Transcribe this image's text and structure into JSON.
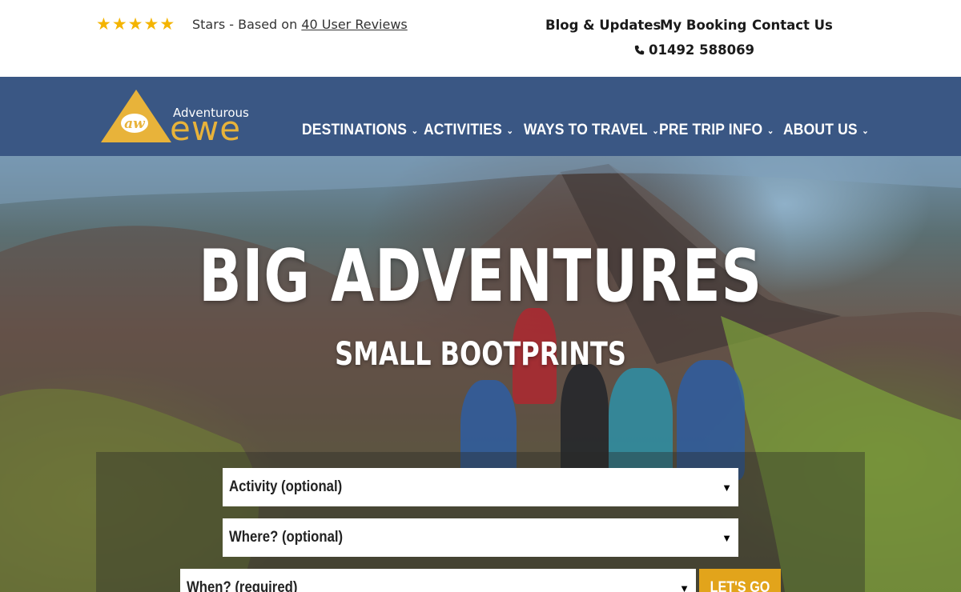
{
  "rating": {
    "stars": 5,
    "text_prefix": "Stars - Based on",
    "reviews_link": "40 User Reviews"
  },
  "top_links": {
    "blog": "Blog & Updates",
    "booking": "My Booking",
    "contact": "Contact Us",
    "phone": "01492 588069"
  },
  "logo": {
    "small": "Adventurous",
    "big": "ewe",
    "badge": "aw"
  },
  "nav": {
    "destinations": "DESTINATIONS",
    "activities": "ACTIVITIES",
    "ways": "WAYS TO TRAVEL",
    "pretrip": "PRE TRIP INFO",
    "about": "ABOUT US"
  },
  "hero": {
    "title": "BIG ADVENTURES",
    "subtitle": "SMALL BOOTPRINTS"
  },
  "search": {
    "activity": "Activity (optional)",
    "where": "Where? (optional)",
    "when": "When? (required)",
    "button": "LET'S GO"
  },
  "colors": {
    "nav_bg": "#3a5784",
    "accent": "#e2a41b",
    "stars": "#f4b400"
  }
}
